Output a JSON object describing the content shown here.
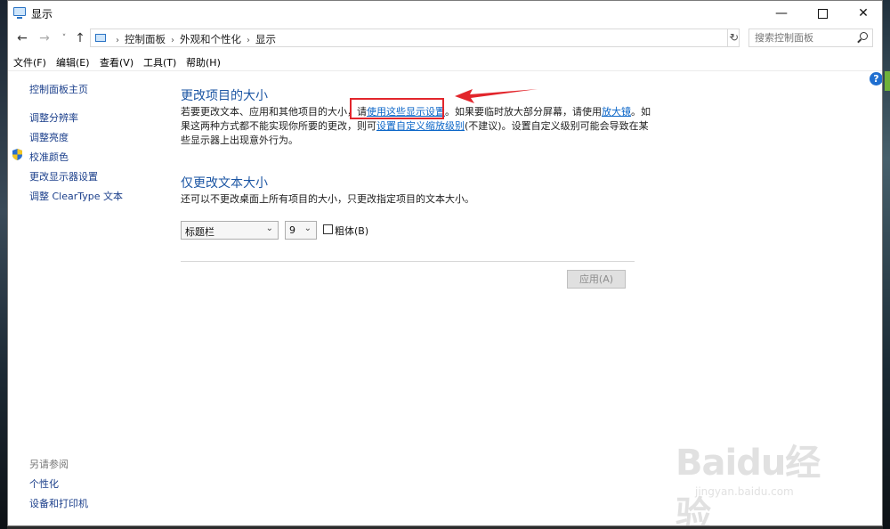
{
  "window": {
    "title": "显示",
    "controls": {
      "minimize": "—",
      "maximize": "",
      "close": "✕"
    }
  },
  "nav": {
    "back": "←",
    "forward": "→",
    "recent": "˅",
    "up": "↑",
    "breadcrumbs": [
      "控制面板",
      "外观和个性化",
      "显示"
    ],
    "crumb_sep": "›",
    "dropdown": "⌄",
    "refresh": "↻",
    "search_placeholder": "搜索控制面板"
  },
  "menu": [
    "文件(F)",
    "编辑(E)",
    "查看(V)",
    "工具(T)",
    "帮助(H)"
  ],
  "sidebar": {
    "home": "控制面板主页",
    "links": [
      "调整分辨率",
      "调整亮度",
      "校准颜色",
      "更改显示器设置",
      "调整 ClearType 文本"
    ],
    "see_also_title": "另请参阅",
    "see_also": [
      "个性化",
      "设备和打印机"
    ]
  },
  "main": {
    "section1": {
      "heading": "更改项目的大小",
      "text_a": "若要更改文本、应用和其他项目的大小，请",
      "link_a": "使用这些显示设置",
      "text_b": "。如果要临时放大部分屏幕，请使用",
      "link_b": "放大镜",
      "text_c": "。如",
      "line2_a": "果这两种方式都不能实现你所要的更改，则可",
      "link_c": "设置自定义缩放级别",
      "line2_b": "(不建议)。设置自定义级别可能会导致在某",
      "line3": "些显示器上出现意外行为。"
    },
    "section2": {
      "heading": "仅更改文本大小",
      "text": "还可以不更改桌面上所有项目的大小，只更改指定项目的文本大小。",
      "item_select": "标题栏",
      "size_select": "9",
      "bold_label": "粗体(B)",
      "apply": "应用(A)"
    },
    "help": "?"
  },
  "watermark": {
    "logo": "Baidu经验",
    "url": "jingyan.baidu.com"
  }
}
